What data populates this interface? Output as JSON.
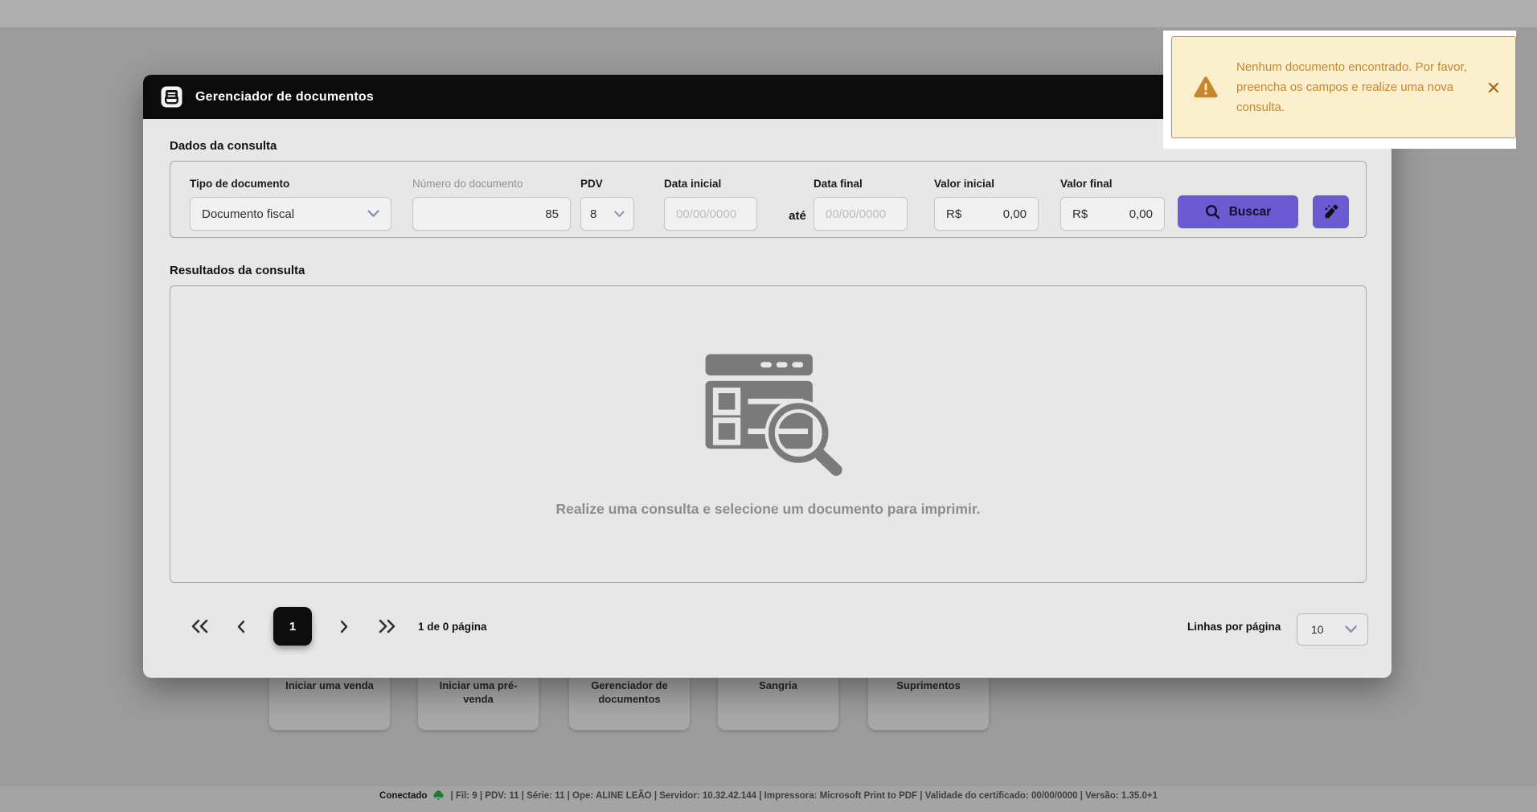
{
  "colors": {
    "accent": "#6B5BD2",
    "titlebar": "#0B0B0B",
    "toast_bg": "#FAF0CD",
    "toast_border": "#C9912C",
    "toast_text": "#C8862C",
    "dim_bg": "#9C9C9C",
    "status_green": "#1F7A33"
  },
  "window": {
    "title": "Gerenciador de documentos"
  },
  "toast": {
    "message": "Nenhum documento encontrado. Por favor, preencha os campos e realize uma nova consulta.",
    "icon": "warning-triangle",
    "close_icon": "close-x"
  },
  "query_form": {
    "section_title": "Dados da consulta",
    "fields": {
      "tipo_documento": {
        "label": "Tipo de documento",
        "value": "Documento fiscal"
      },
      "numero_documento": {
        "label": "Número do documento",
        "value": "85"
      },
      "pdv": {
        "label": "PDV",
        "value": "8"
      },
      "data_inicial": {
        "label": "Data inicial",
        "placeholder": "00/00/0000"
      },
      "range_separator": "até",
      "data_final": {
        "label": "Data final",
        "placeholder": "00/00/0000"
      },
      "valor_inicial": {
        "label": "Valor inicial",
        "prefix": "R$",
        "value": "0,00"
      },
      "valor_final": {
        "label": "Valor final",
        "prefix": "R$",
        "value": "0,00"
      }
    },
    "search_button_label": "Buscar"
  },
  "results": {
    "section_title": "Resultados da consulta",
    "empty_message": "Realize uma consulta e selecione um documento para imprimir."
  },
  "pagination": {
    "current_page": "1",
    "page_info": "1 de 0 página",
    "rows_per_page_label": "Linhas por página",
    "rows_per_page_value": "10"
  },
  "background": {
    "tiles": [
      {
        "label": "Iniciar uma venda"
      },
      {
        "label": "Iniciar uma pré-venda"
      },
      {
        "label": "Gerenciador de documentos"
      },
      {
        "label": "Sangria"
      },
      {
        "label": "Suprimentos"
      }
    ],
    "status_bar": {
      "connected_label": "Conectado",
      "details": "| Fil: 9 | PDV: 11 | Série: 11 | Ope: ALINE LEÃO | Servidor: 10.32.42.144 | Impressora: Microsoft Print to PDF | Validade do certificado: 00/00/0000 | Versão: 1.35.0+1"
    }
  }
}
